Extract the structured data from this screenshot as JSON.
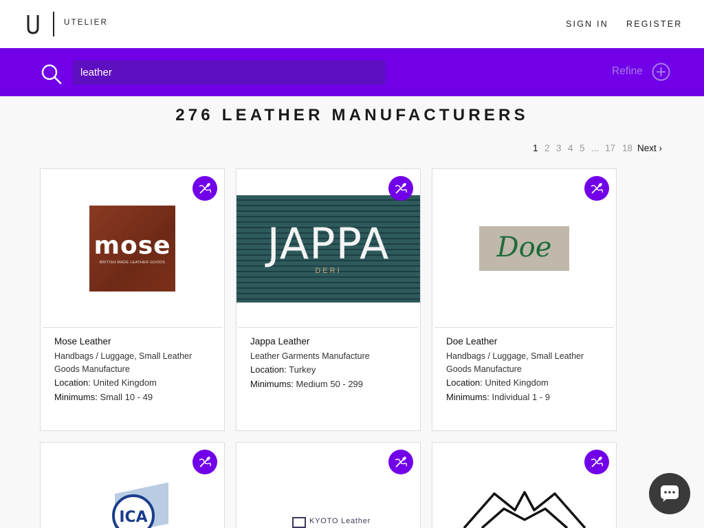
{
  "brand": {
    "mark": "U",
    "name": "UTELIER"
  },
  "nav": {
    "sign_in": "SIGN IN",
    "register": "REGISTER"
  },
  "search": {
    "value": "leather",
    "refine_label": "Refine"
  },
  "results": {
    "title": "276 LEATHER MANUFACTURERS"
  },
  "pagination": {
    "current": "1",
    "pages": [
      "2",
      "3",
      "4",
      "5"
    ],
    "ellipsis": "...",
    "last_pages": [
      "17",
      "18"
    ],
    "next_label": "Next ›"
  },
  "labels": {
    "location": "Location:",
    "minimums": "Minimums:"
  },
  "cards": [
    {
      "name": "Mose Leather",
      "category": "Handbags / Luggage, Small Leather Goods Manufacture",
      "location": "United Kingdom",
      "minimums": "Small 10 - 49",
      "logo_text": "mose",
      "logo_subtext": "BRITISH MADE LEATHER GOODS"
    },
    {
      "name": "Jappa Leather",
      "category": "Leather Garments Manufacture",
      "location": "Turkey",
      "minimums": "Medium 50 - 299",
      "logo_text": "JAPPA",
      "logo_subtext": "DERİ"
    },
    {
      "name": "Doe Leather",
      "category": "Handbags / Luggage, Small Leather Goods Manufacture",
      "location": "United Kingdom",
      "minimums": "Individual 1 - 9",
      "logo_text": "Doe"
    },
    {
      "logo_text": "ICA"
    },
    {
      "logo_text": "KYOTO Leather"
    },
    {
      "logo_icon": "mountains-icon"
    }
  ],
  "icons": {
    "search": "search-icon",
    "refine": "plus-circle-icon",
    "favorite": "needle-thread-icon",
    "chat": "chat-icon"
  },
  "colors": {
    "accent": "#7100e8",
    "search_field": "#5e0fc0",
    "chat_button": "#3a3a3a"
  }
}
